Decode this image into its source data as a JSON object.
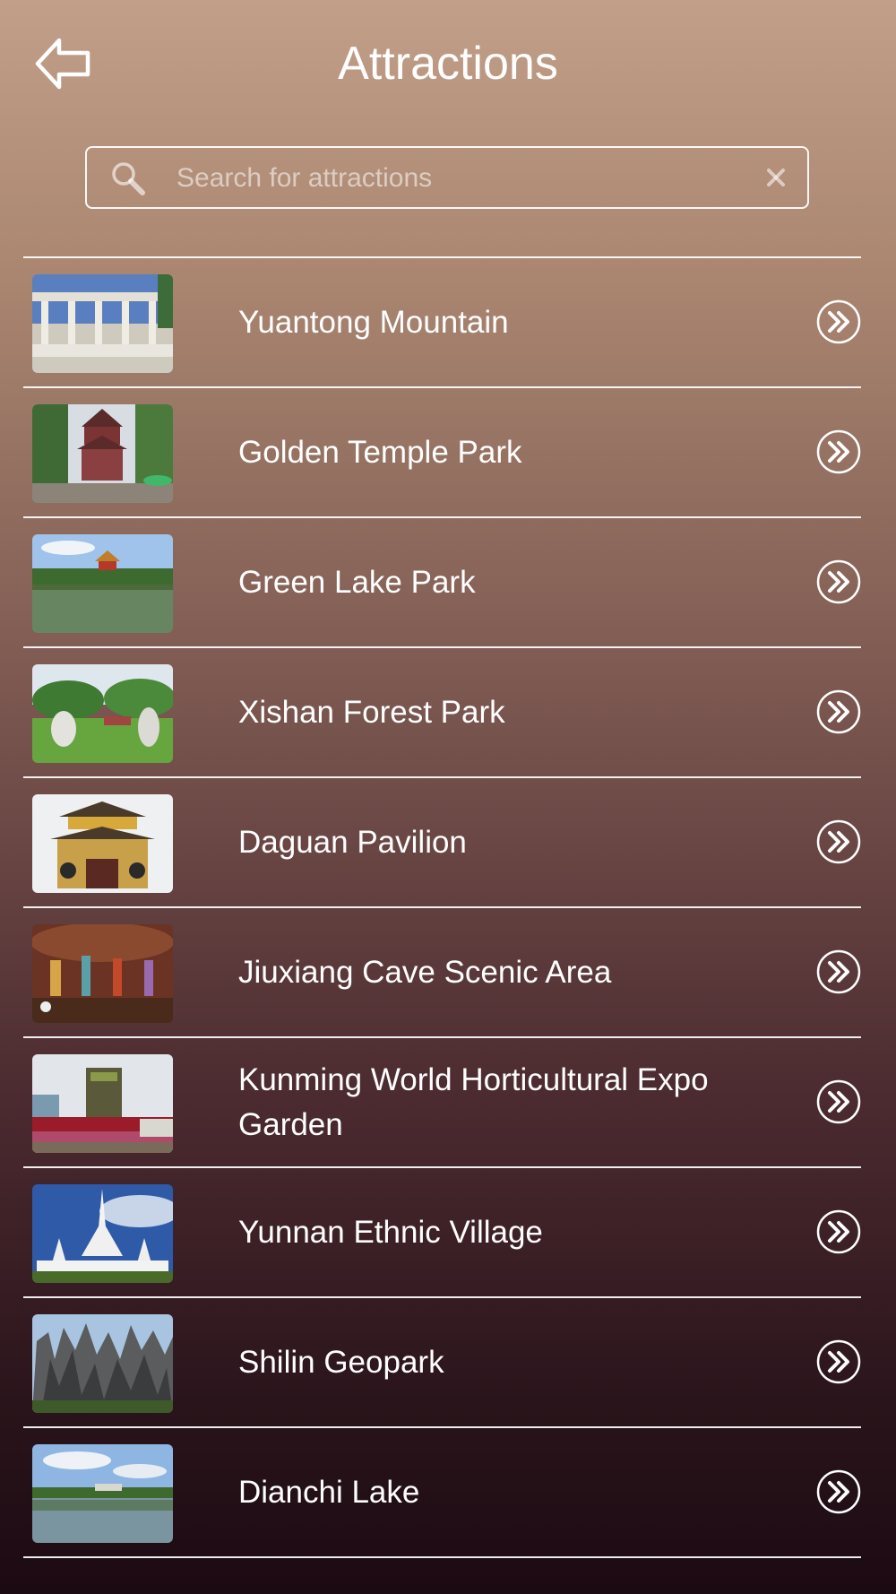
{
  "header": {
    "title": "Attractions"
  },
  "search": {
    "placeholder": "Search for attractions"
  },
  "attractions": [
    {
      "name": "Yuantong Mountain"
    },
    {
      "name": "Golden Temple Park"
    },
    {
      "name": "Green Lake Park"
    },
    {
      "name": "Xishan Forest Park"
    },
    {
      "name": "Daguan Pavilion"
    },
    {
      "name": "Jiuxiang Cave Scenic Area"
    },
    {
      "name": "Kunming World Horticultural Expo Garden"
    },
    {
      "name": "Yunnan Ethnic Village"
    },
    {
      "name": "Shilin Geopark"
    },
    {
      "name": "Dianchi Lake"
    }
  ]
}
